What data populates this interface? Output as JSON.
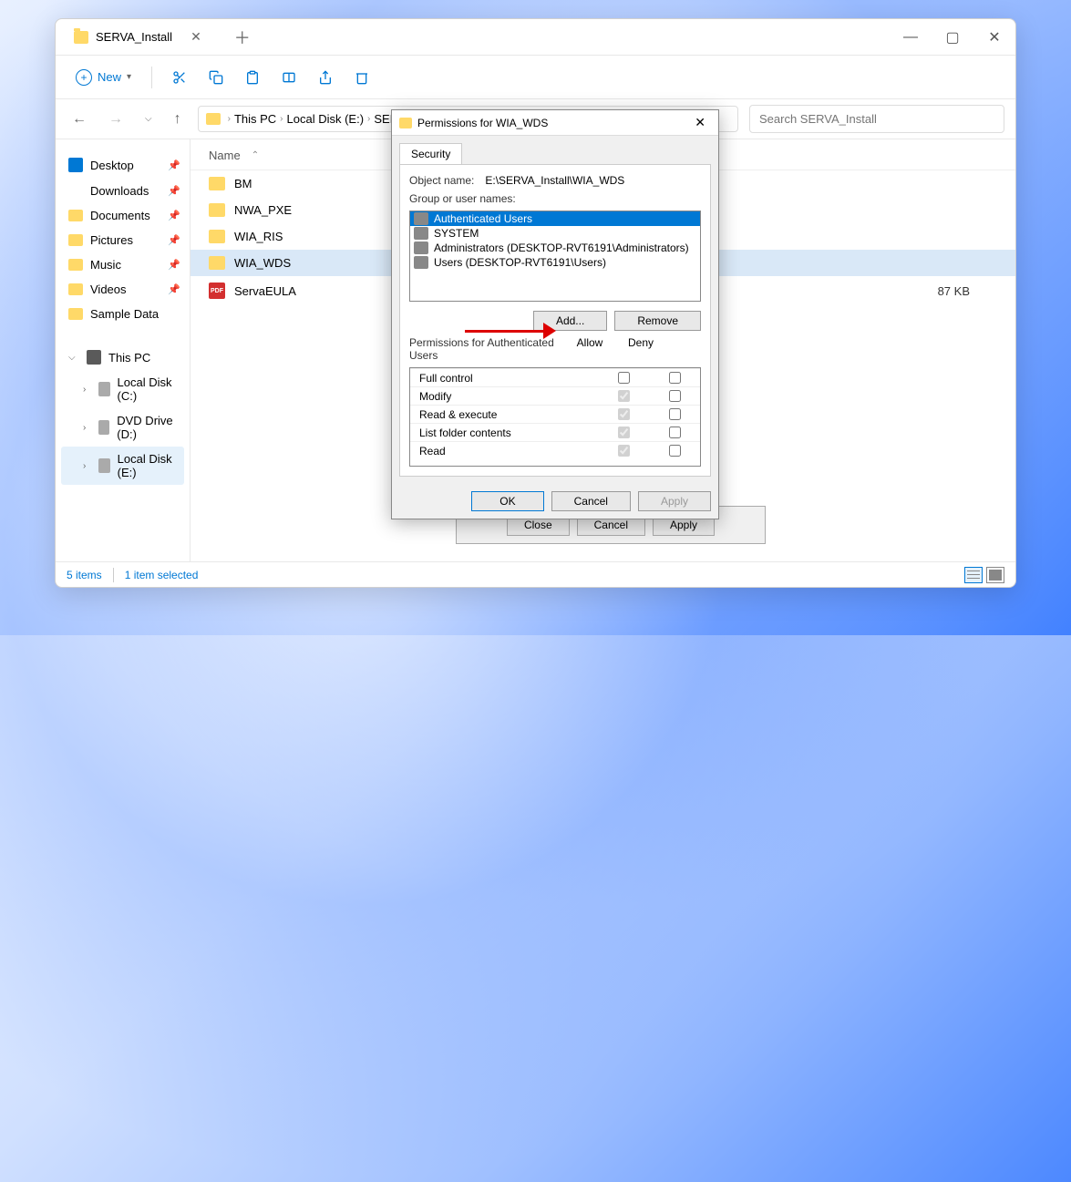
{
  "explorer": {
    "tab_title": "SERVA_Install",
    "toolbar": {
      "new_label": "New"
    },
    "breadcrumb": [
      "This PC",
      "Local Disk (E:)",
      "SERVA_Install"
    ],
    "search_placeholder": "Search SERVA_Install",
    "sidebar": {
      "quick": [
        {
          "label": "Desktop",
          "pinned": true
        },
        {
          "label": "Downloads",
          "pinned": true
        },
        {
          "label": "Documents",
          "pinned": true
        },
        {
          "label": "Pictures",
          "pinned": true
        },
        {
          "label": "Music",
          "pinned": true
        },
        {
          "label": "Videos",
          "pinned": true
        },
        {
          "label": "Sample Data",
          "pinned": false
        }
      ],
      "this_pc": "This PC",
      "drives": [
        {
          "label": "Local Disk (C:)"
        },
        {
          "label": "DVD Drive (D:)"
        },
        {
          "label": "Local Disk (E:)",
          "selected": true
        }
      ]
    },
    "columns": {
      "name": "Name"
    },
    "files": [
      {
        "name": "BM",
        "type": "folder"
      },
      {
        "name": "NWA_PXE",
        "type": "folder"
      },
      {
        "name": "WIA_RIS",
        "type": "folder"
      },
      {
        "name": "WIA_WDS",
        "type": "folder",
        "selected": true
      },
      {
        "name": "ServaEULA",
        "type": "pdf",
        "size": "87 KB"
      }
    ],
    "status": {
      "items": "5 items",
      "selected": "1 item selected"
    }
  },
  "props_dialog": {
    "close": "Close",
    "cancel": "Cancel",
    "apply": "Apply"
  },
  "perm_dialog": {
    "title": "Permissions for WIA_WDS",
    "tab": "Security",
    "object_label": "Object name:",
    "object_value": "E:\\SERVA_Install\\WIA_WDS",
    "group_label": "Group or user names:",
    "users": [
      {
        "name": "Authenticated Users",
        "selected": true
      },
      {
        "name": "SYSTEM"
      },
      {
        "name": "Administrators (DESKTOP-RVT6191\\Administrators)"
      },
      {
        "name": "Users (DESKTOP-RVT6191\\Users)"
      }
    ],
    "add": "Add...",
    "remove": "Remove",
    "perm_for": "Permissions for Authenticated Users",
    "allow": "Allow",
    "deny": "Deny",
    "perms": [
      {
        "name": "Full control",
        "allow": false,
        "deny": false
      },
      {
        "name": "Modify",
        "allow": true,
        "deny": false,
        "disabled": true
      },
      {
        "name": "Read & execute",
        "allow": true,
        "deny": false,
        "disabled": true
      },
      {
        "name": "List folder contents",
        "allow": true,
        "deny": false,
        "disabled": true
      },
      {
        "name": "Read",
        "allow": true,
        "deny": false,
        "disabled": true
      }
    ],
    "ok": "OK",
    "cancel": "Cancel",
    "apply": "Apply"
  }
}
